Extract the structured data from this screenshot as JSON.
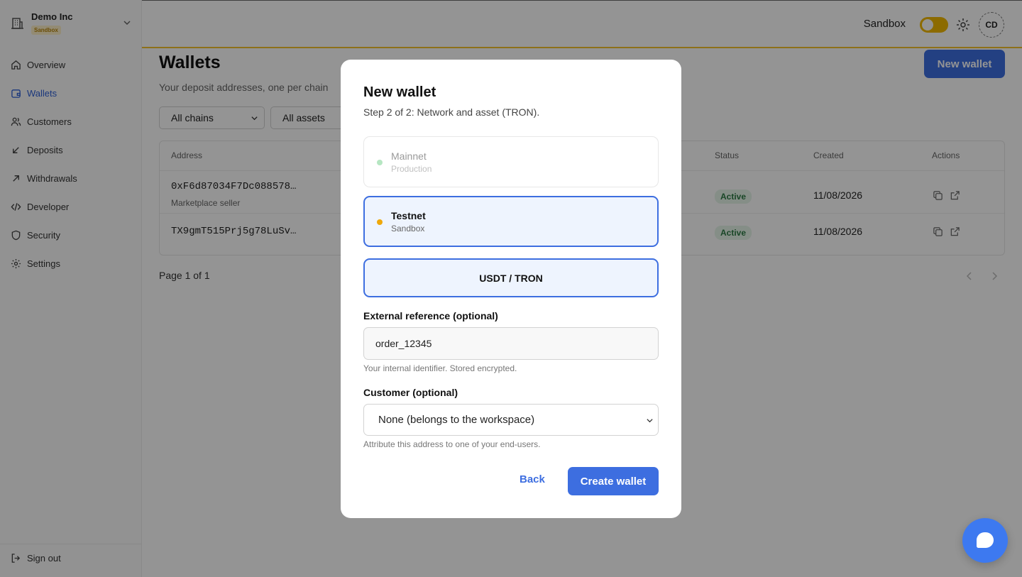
{
  "sidebar": {
    "org_name": "Demo Inc",
    "org_badge": "Sandbox",
    "items": [
      {
        "label": "Overview",
        "icon": "home-icon"
      },
      {
        "label": "Wallets",
        "icon": "wallet-icon",
        "active": true
      },
      {
        "label": "Customers",
        "icon": "users-icon"
      },
      {
        "label": "Deposits",
        "icon": "arrow-down-left-icon"
      },
      {
        "label": "Withdrawals",
        "icon": "arrow-up-right-icon"
      },
      {
        "label": "Developer",
        "icon": "code-icon"
      },
      {
        "label": "Security",
        "icon": "shield-icon"
      },
      {
        "label": "Settings",
        "icon": "gear-icon"
      }
    ],
    "sign_out": "Sign out"
  },
  "topbar": {
    "sandbox_label": "Sandbox",
    "sandbox_on": true,
    "avatar_initials": "CD"
  },
  "page": {
    "title": "Wallets",
    "subtitle": "Your deposit addresses, one per chain",
    "new_wallet_label": "New wallet",
    "filters": [
      "All chains",
      "All assets"
    ],
    "table": {
      "columns": [
        "Address",
        "Status",
        "Created",
        "Actions"
      ],
      "rows": [
        {
          "address": "0xF6d87034F7Dc088578…",
          "label": "Marketplace seller",
          "status": "Active",
          "created": "11/08/2026"
        },
        {
          "address": "TX9gmT515Prj5g78LuSv…",
          "label": "",
          "status": "Active",
          "created": "11/08/2026"
        }
      ]
    },
    "pagination": "Page 1 of 1"
  },
  "modal": {
    "title": "New wallet",
    "subtitle": "Step 2 of 2: Network and asset (TRON).",
    "networks": [
      {
        "name": "Mainnet",
        "sub": "Production",
        "selected": false
      },
      {
        "name": "Testnet",
        "sub": "Sandbox",
        "selected": true
      }
    ],
    "asset": "USDT / TRON",
    "ext_ref_label": "External reference (optional)",
    "ext_ref_value": "order_12345",
    "ext_ref_help": "Your internal identifier. Stored encrypted.",
    "customer_label": "Customer (optional)",
    "customer_value": "None (belongs to the workspace)",
    "customer_help": "Attribute this address to one of your end-users.",
    "back_label": "Back",
    "create_label": "Create wallet"
  },
  "colors": {
    "accent": "#3d6ee0",
    "sandbox_yellow": "#f1b800",
    "active_green": "#2c7a44"
  }
}
